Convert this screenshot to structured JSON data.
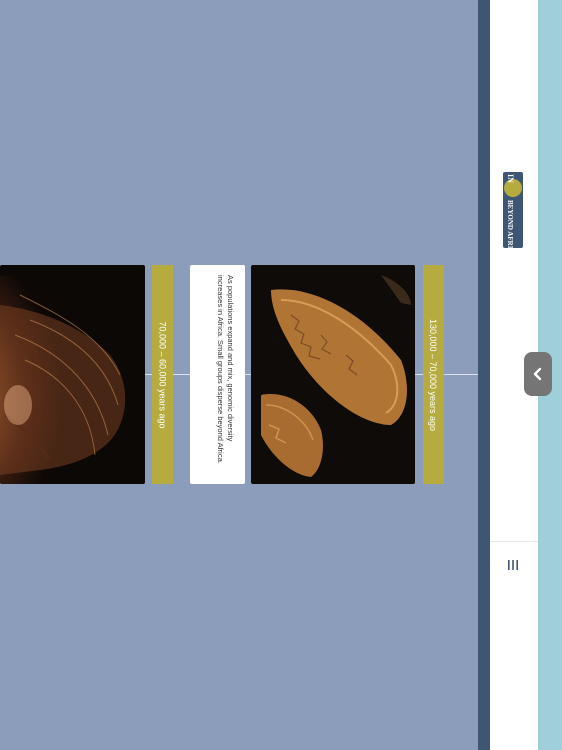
{
  "timeline": {
    "eras": [
      {
        "label": "130,000 – 70,000 years ago"
      },
      {
        "label": "70,000 – 60,000 years ago"
      }
    ],
    "card_text": "As populations expand and mix, genomic diversity increases in Africa. Small groups disperse beyond Africa."
  },
  "sidebar": {
    "logo_text": "IN & BEYOND AFRICA",
    "logo_lines": [
      "IN",
      "BEYOND AFRICA"
    ],
    "back_icon": "chevron-left-icon",
    "menu_icon": "menu-bars-icon"
  },
  "colors": {
    "background": "#8c9dbb",
    "era_tab": "#b5ab3f",
    "sidebar_dark": "#3e5674",
    "sidebar_light": "#9fd0da",
    "button": "#757575"
  }
}
